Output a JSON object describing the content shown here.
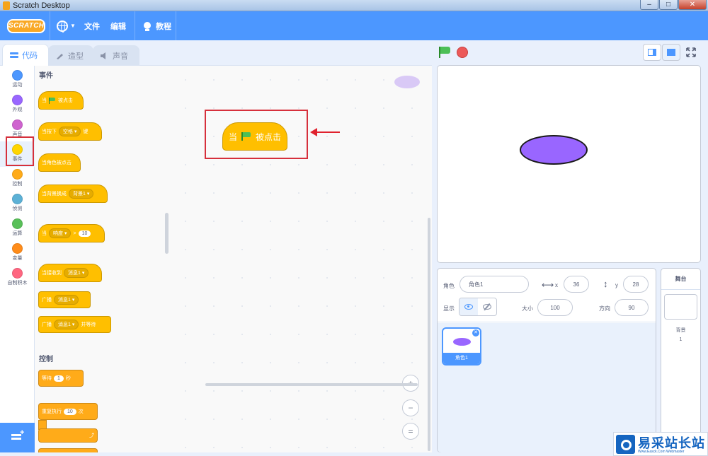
{
  "window": {
    "title": "Scratch Desktop",
    "buttons": [
      "–",
      "□",
      "✕"
    ]
  },
  "menubar": {
    "logo": "SCRATCH",
    "file": "文件",
    "edit": "编辑",
    "tutorials": "教程"
  },
  "tabs": {
    "code": "代码",
    "costumes": "造型",
    "sounds": "声音"
  },
  "categories": [
    {
      "label": "运动",
      "color": "#4c97ff"
    },
    {
      "label": "外观",
      "color": "#9966ff"
    },
    {
      "label": "声音",
      "color": "#cf63cf"
    },
    {
      "label": "事件",
      "color": "#ffd500"
    },
    {
      "label": "控制",
      "color": "#ffab19"
    },
    {
      "label": "侦测",
      "color": "#5cb1d6"
    },
    {
      "label": "运算",
      "color": "#59c059"
    },
    {
      "label": "变量",
      "color": "#ff8c1a"
    },
    {
      "label": "自制积木",
      "color": "#ff6680"
    }
  ],
  "palette": {
    "events_header": "事件",
    "control_header": "控制",
    "when_flag_a": "当",
    "when_flag_b": "被点击",
    "when_key_a": "当按下",
    "when_key_dd": "空格",
    "when_key_b": "键",
    "when_sprite_clicked": "当角色被点击",
    "when_backdrop_a": "当背景换成",
    "when_backdrop_dd": "背景1",
    "when_loud_a": "当",
    "when_loud_dd": "响度",
    "when_loud_op": ">",
    "when_loud_val": "10",
    "when_receive_a": "当接收到",
    "when_receive_dd": "消息1",
    "broadcast_a": "广播",
    "broadcast_dd": "消息1",
    "broadcast_wait_a": "广播",
    "broadcast_wait_dd": "消息1",
    "broadcast_wait_b": "并等待",
    "wait_a": "等待",
    "wait_val": "1",
    "wait_b": "秒",
    "repeat_a": "重复执行",
    "repeat_val": "10",
    "repeat_b": "次"
  },
  "script": {
    "hat_a": "当",
    "hat_b": "被点击"
  },
  "zoom": {
    "in": "+",
    "out": "−",
    "reset": "="
  },
  "sprite_info": {
    "sprite_label": "角色",
    "sprite_name": "角色1",
    "x_label": "x",
    "x_value": "36",
    "y_label": "y",
    "y_value": "28",
    "show_label": "显示",
    "size_label": "大小",
    "size_value": "100",
    "direction_label": "方向",
    "direction_value": "90"
  },
  "sprites": [
    {
      "name": "角色1"
    }
  ],
  "stage_selector": {
    "title": "舞台",
    "backdrops_label": "背景",
    "backdrops_count": "1"
  },
  "watermark": {
    "title": "易采站长站",
    "subtitle": "Www.Easck.Com Webmaster"
  },
  "colors": {
    "accent": "#4c97ff",
    "events": "#ffbf00",
    "highlight": "#d6303c"
  }
}
